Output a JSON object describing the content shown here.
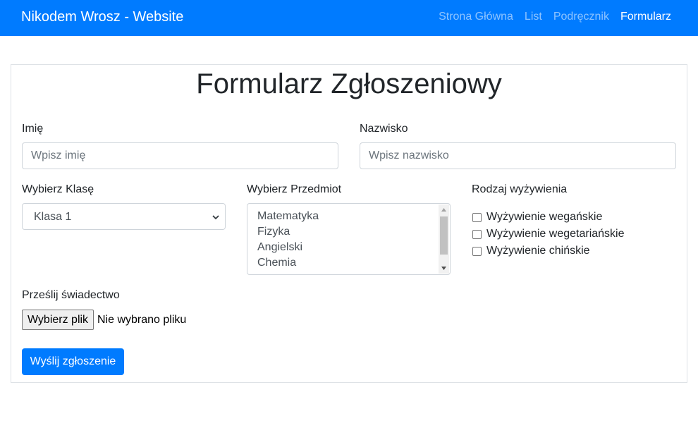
{
  "navbar": {
    "brand": "Nikodem Wrosz - Website",
    "links": [
      {
        "label": "Strona Główna",
        "active": false
      },
      {
        "label": "List",
        "active": false
      },
      {
        "label": "Podręcznik",
        "active": false
      },
      {
        "label": "Formularz",
        "active": true
      }
    ],
    "bg_color": "#007bff"
  },
  "form": {
    "title": "Formularz Zgłoszeniowy",
    "first_name": {
      "label": "Imię",
      "placeholder": "Wpisz imię",
      "value": ""
    },
    "last_name": {
      "label": "Nazwisko",
      "placeholder": "Wpisz nazwisko",
      "value": ""
    },
    "class_select": {
      "label": "Wybierz Klasę",
      "selected": "Klasa 1"
    },
    "subject_list": {
      "label": "Wybierz Przedmiot",
      "options": [
        "Matematyka",
        "Fizyka",
        "Angielski",
        "Chemia"
      ]
    },
    "diet": {
      "label": "Rodzaj wyżywienia",
      "options": [
        "Wyżywienie wegańskie",
        "Wyżywienie wegetariańskie",
        "Wyżywienie chińskie"
      ]
    },
    "certificate": {
      "label": "Prześlij świadectwo",
      "button_label": "Wybierz plik",
      "status": "Nie wybrano pliku"
    },
    "submit_label": "Wyślij zgłoszenie",
    "accent_color": "#007bff"
  }
}
